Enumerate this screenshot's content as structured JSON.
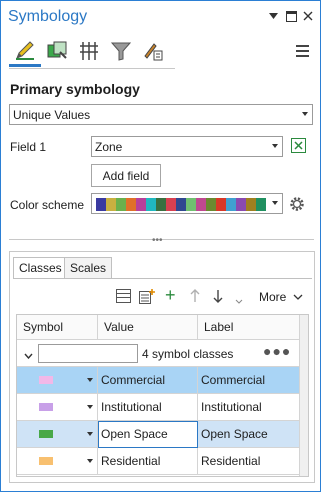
{
  "window": {
    "title": "Symbology"
  },
  "panel": {
    "section_title": "Primary symbology",
    "renderer": "Unique Values",
    "field1_label": "Field 1",
    "field1_value": "Zone",
    "add_field_label": "Add field",
    "color_scheme_label": "Color scheme",
    "ramp_colors": [
      "#3a3aa0",
      "#c8b040",
      "#6ab04c",
      "#e0702a",
      "#b8409a",
      "#20b8c0",
      "#3a7040",
      "#d84050",
      "#304890",
      "#70c070",
      "#c04890",
      "#6a8a30",
      "#d83828",
      "#40a0d0",
      "#8a4ab0",
      "#a08020",
      "#209060"
    ]
  },
  "tabs": [
    {
      "label": "Classes",
      "active": true
    },
    {
      "label": "Scales",
      "active": false
    }
  ],
  "toolbar": {
    "more_label": "More"
  },
  "grid": {
    "columns": [
      "Symbol",
      "Value",
      "Label"
    ],
    "summary": "4 symbol classes",
    "filter_value": "",
    "rows": [
      {
        "value": "Commercial",
        "label": "Commercial",
        "color": "#f2b8e8",
        "state": "selected"
      },
      {
        "value": "Institutional",
        "label": "Institutional",
        "color": "#c8a0e8",
        "state": "normal"
      },
      {
        "value": "Open Space",
        "label": "Open Space",
        "color": "#48a848",
        "state": "focused"
      },
      {
        "value": "Residential",
        "label": "Residential",
        "color": "#f8c070",
        "state": "normal"
      }
    ]
  }
}
